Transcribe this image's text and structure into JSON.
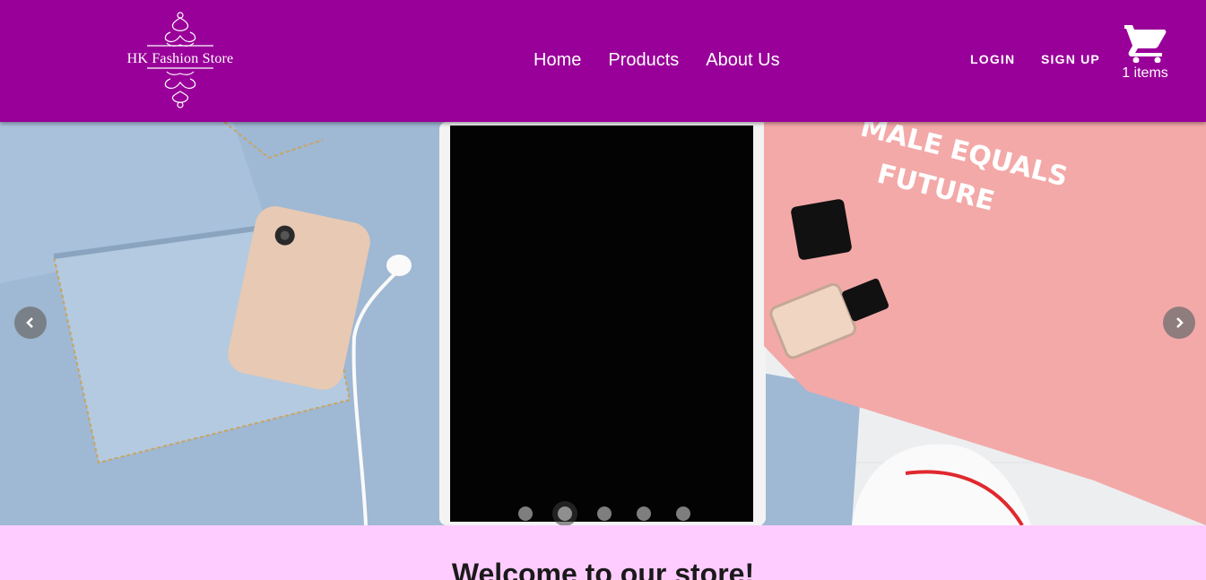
{
  "brand": {
    "name": "HK Fashion Store"
  },
  "nav": {
    "items": [
      "Home",
      "Products",
      "About Us"
    ]
  },
  "auth": {
    "login": "LOGIN",
    "signup": "SIGN UP"
  },
  "cart": {
    "count_label": "1 items",
    "icon": "shopping-cart-icon"
  },
  "carousel": {
    "slide_count": 5,
    "active_index": 1,
    "prev_icon": "chevron-left-icon",
    "next_icon": "chevron-right-icon",
    "shirt_text_line1": "MALE EQUALS",
    "shirt_text_line2": "FUTURE"
  },
  "welcome": {
    "title": "Welcome to our store!"
  },
  "colors": {
    "header": "#990099",
    "page_background": "#ffccff",
    "text": "#ffffff"
  }
}
